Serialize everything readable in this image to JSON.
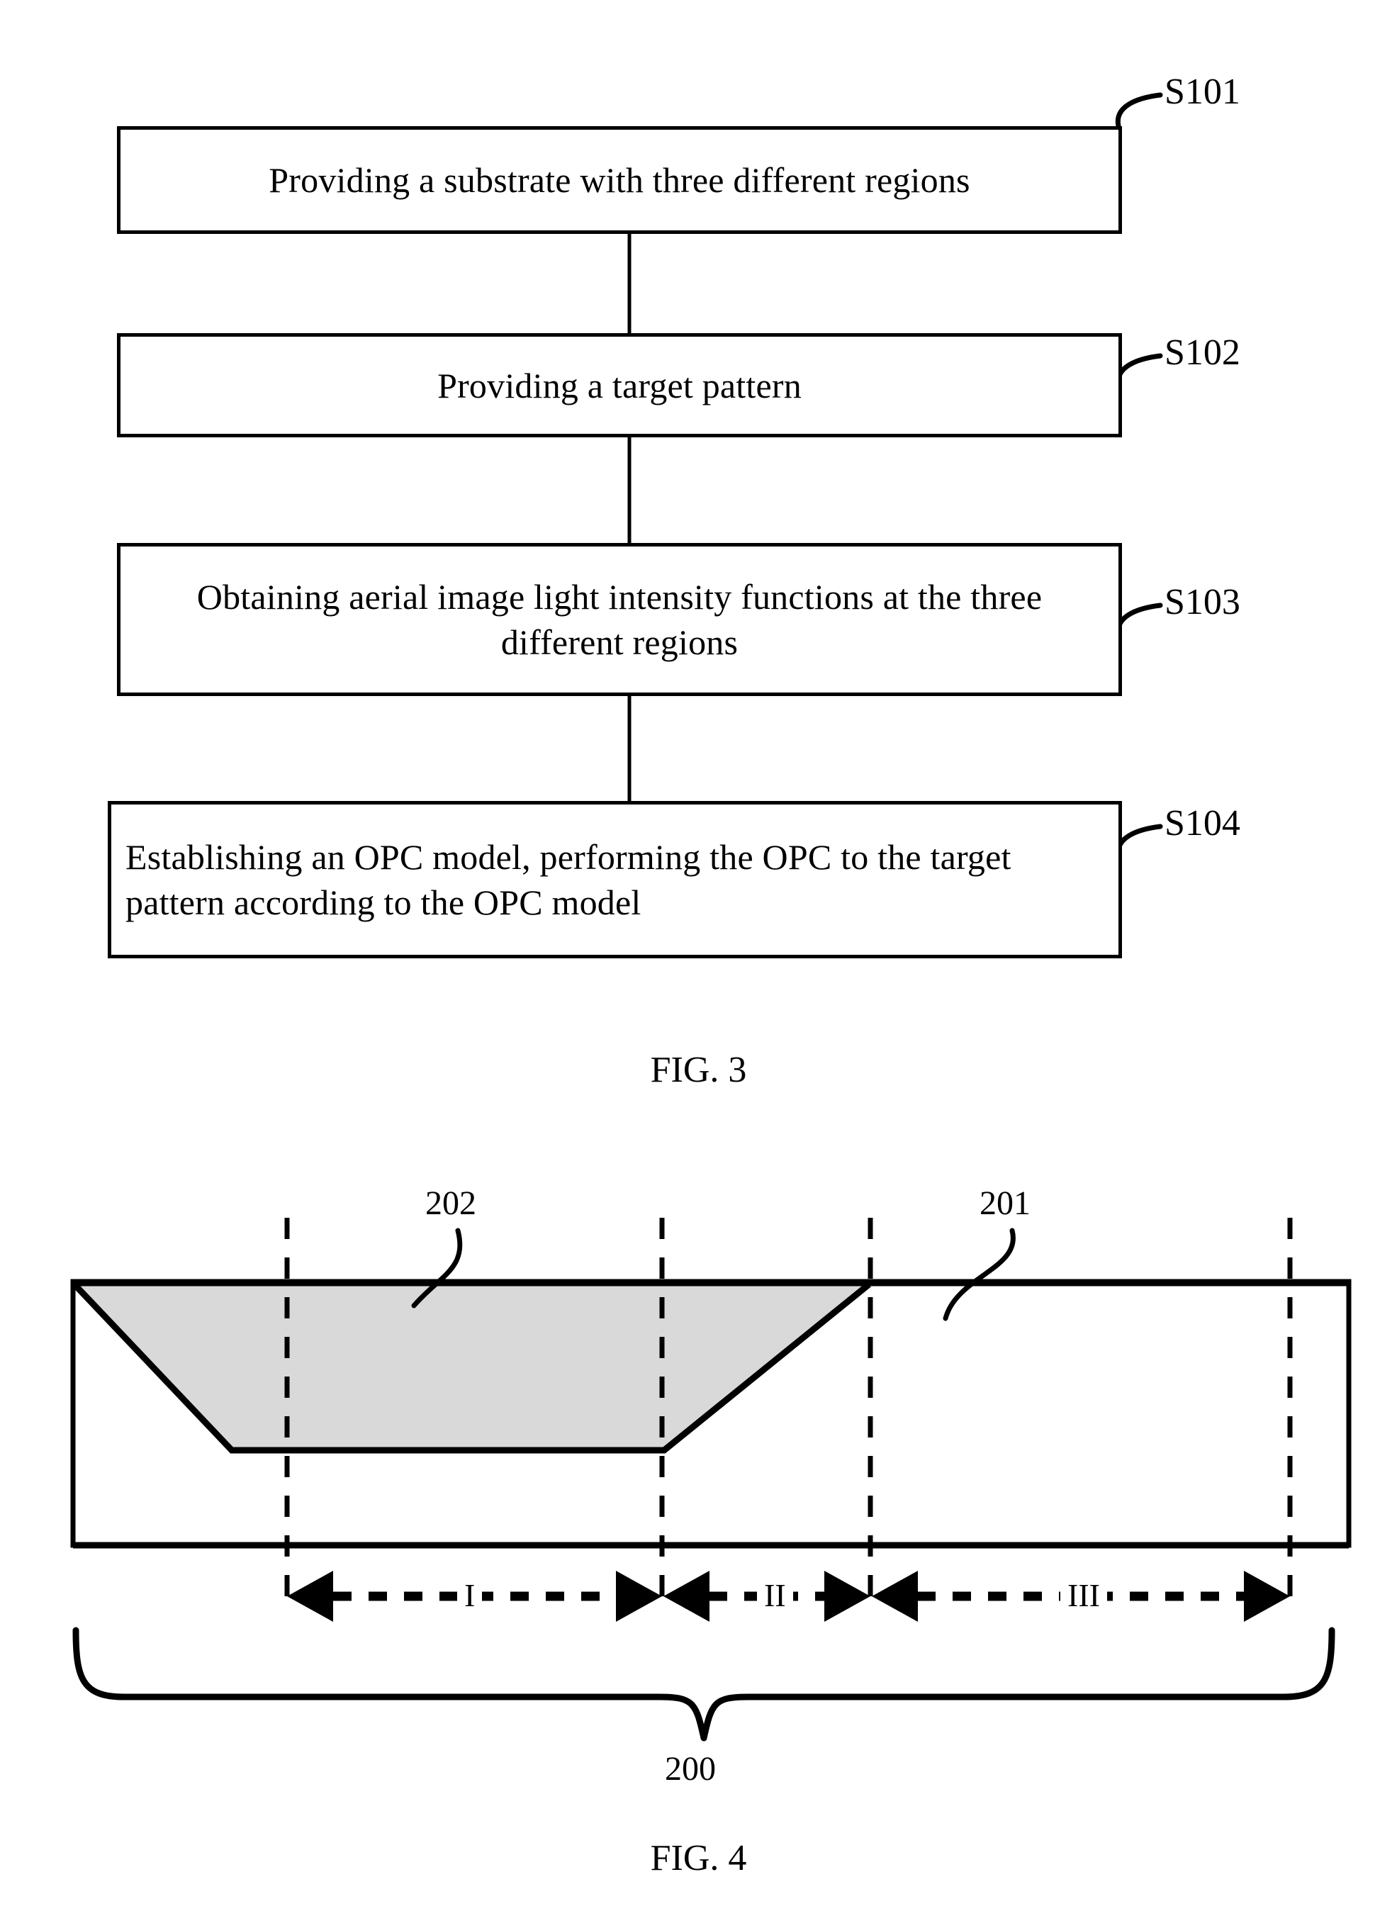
{
  "document": {
    "kind": "patent-drawing-sheet",
    "background_color": "#ffffff",
    "line_color": "#000000"
  },
  "fig3": {
    "caption": "FIG. 3",
    "steps": [
      {
        "id": "S101",
        "label": "S101",
        "text": "Providing a substrate with three different regions"
      },
      {
        "id": "S102",
        "label": "S102",
        "text": "Providing a target pattern"
      },
      {
        "id": "S103",
        "label": "S103",
        "text": "Obtaining aerial image light intensity functions at the three different regions"
      },
      {
        "id": "S104",
        "label": "S104",
        "text": "Establishing an OPC model, performing the OPC to the target pattern according to the OPC model"
      }
    ]
  },
  "fig4": {
    "caption": "FIG. 4",
    "reference_numerals": [
      {
        "label": "202",
        "describes": "shaded-trapezoid-feature"
      },
      {
        "label": "201",
        "describes": "flat-substrate-surface"
      },
      {
        "label": "200",
        "describes": "whole-substrate"
      }
    ],
    "regions": [
      {
        "label": "I"
      },
      {
        "label": "II"
      },
      {
        "label": "III"
      }
    ],
    "fill_color": "#d9d9d9"
  }
}
